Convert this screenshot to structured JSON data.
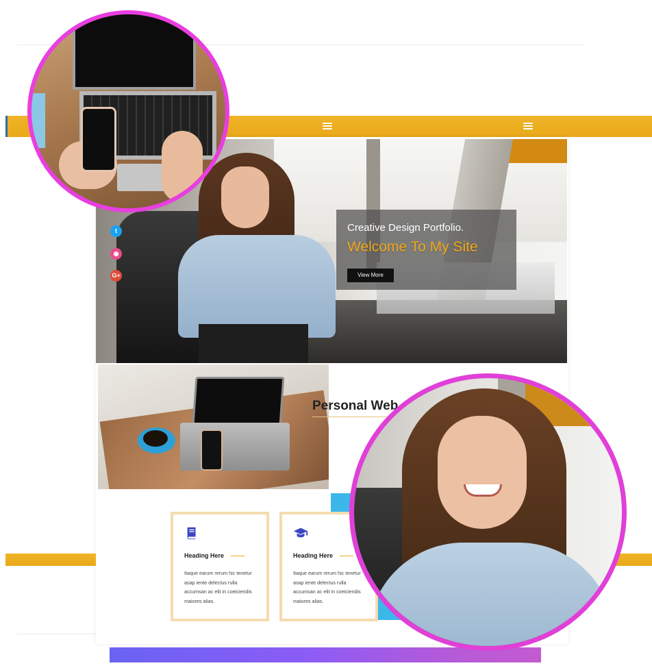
{
  "hero": {
    "subtitle": "Creative Design Portfolio.",
    "title": "Welcome To My Site",
    "button_label": "View More"
  },
  "social": {
    "twitter_glyph": "t",
    "dribbble_glyph": "◉",
    "googleplus_glyph": "G+"
  },
  "about": {
    "heading": "Personal Web"
  },
  "cards": [
    {
      "icon": "book-icon",
      "heading": "Heading Here",
      "text": "Itaque earum rerum hic tenetur asap iente delectus rulla accumsan ac elit in coeiciendis maiores alias."
    },
    {
      "icon": "graduation-cap-icon",
      "heading": "Heading Here",
      "text": "Itaque earum rerum hic tenetur asap iente delectus rulla accumsan ac elit in coeiciendis maiores alias."
    }
  ],
  "colors": {
    "accent_gold": "#f0b429",
    "title_orange": "#f0a81a",
    "circle_border": "#e93ee0",
    "icon_blue": "#3b46c4",
    "gradient_start": "#6a63f2",
    "gradient_end": "#c45ad0"
  }
}
